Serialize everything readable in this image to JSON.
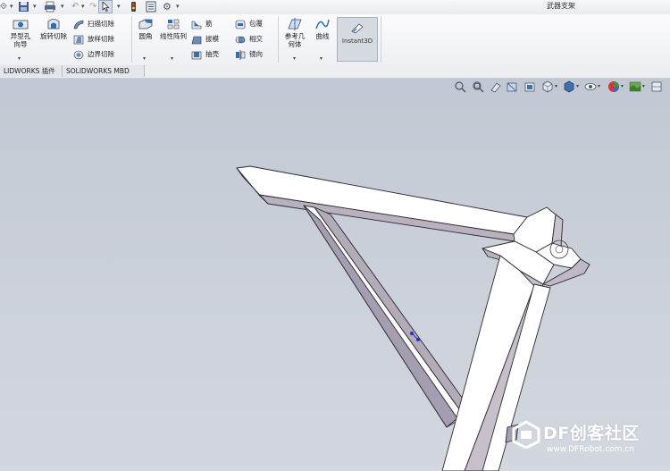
{
  "window": {
    "document_title": "武器支架"
  },
  "ribbon": {
    "hole_wizard": "异型孔向导",
    "revolved_cut": "旋转切除",
    "swept_cut": "扫描切除",
    "lofted_cut": "放样切除",
    "boundary_cut": "边界切除",
    "fillet": "圆角",
    "linear_pattern": "线性阵列",
    "rib": "筋",
    "draft": "拔模",
    "shell": "抽壳",
    "wrap": "包覆",
    "intersect": "相交",
    "mirror": "镜向",
    "reference_geometry": "参考几何体",
    "curves": "曲线",
    "instant3d": "Instant3D"
  },
  "tabs": [
    {
      "label": "LIDWORKS 插件"
    },
    {
      "label": "SOLIDWORKS MBD"
    }
  ],
  "watermark": {
    "title": "DF创客社区",
    "url": "www.DFRobot.com.cn"
  },
  "colors": {
    "accent": "#2f6fb3",
    "model_face": "#ffffff",
    "model_side": "#b8b0bc",
    "viewport": "#c8cdd6"
  }
}
